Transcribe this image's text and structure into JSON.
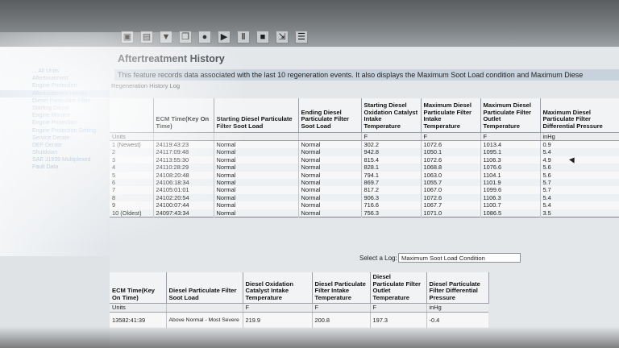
{
  "page": {
    "title": "Aftertreatment History",
    "description": "This feature records data associated with the last 10 regeneration events. It also displays the Maximum Soot Load condition and Maximum Diese",
    "log_label": "Regeneration History Log"
  },
  "toolbar": {
    "icons": [
      "save-icon",
      "print-icon",
      "filter-icon",
      "copy-icon",
      "record-icon",
      "play-icon",
      "pause-icon",
      "stop-icon",
      "export-icon",
      "report-icon"
    ]
  },
  "sidebar": {
    "items": [
      "... All Units",
      "Aftertreatment",
      "Engine Protection",
      "Aftertreatment History",
      "Diesel Particulate Filter",
      "Starting Diesel",
      "Engine Monitor",
      "Engine Protection",
      "Engine Protection Setting",
      "Service Derate",
      "DEF Derate",
      "Shutdown",
      "SAE J1939 Multiplexed",
      "Fault Data"
    ]
  },
  "regen_table": {
    "columns": [
      "ECM Time(Key On Time)",
      "Starting Diesel Particulate Filter Soot Load",
      "Ending Diesel Particulate Filter Soot Load",
      "Starting Diesel Oxidation Catalyst Intake Temperature",
      "Maximum Diesel Particulate Filter Intake Temperature",
      "Maximum Diesel Particulate Filter Outlet Temperature",
      "Maximum Diesel Particulate Filter Differential Pressure"
    ],
    "units_label": "Units",
    "units": [
      "",
      "",
      "",
      "F",
      "F",
      "F",
      "inHg"
    ],
    "rows": [
      {
        "idx": "1 (Newest)",
        "cells": [
          "24119:43:23",
          "Normal",
          "Normal",
          "302.2",
          "1072.6",
          "1013.4",
          "0.9"
        ]
      },
      {
        "idx": "2",
        "cells": [
          "24117:09:48",
          "Normal",
          "Normal",
          "942.8",
          "1050.1",
          "1095.1",
          "5.4"
        ]
      },
      {
        "idx": "3",
        "cells": [
          "24113:55:30",
          "Normal",
          "Normal",
          "815.4",
          "1072.6",
          "1106.3",
          "4.9"
        ]
      },
      {
        "idx": "4",
        "cells": [
          "24110:28:29",
          "Normal",
          "Normal",
          "828.1",
          "1068.8",
          "1076.6",
          "5.6"
        ]
      },
      {
        "idx": "5",
        "cells": [
          "24108:20:48",
          "Normal",
          "Normal",
          "794.1",
          "1063.0",
          "1104.1",
          "5.6"
        ]
      },
      {
        "idx": "6",
        "cells": [
          "24106:18:34",
          "Normal",
          "Normal",
          "869.7",
          "1055.7",
          "1101.9",
          "5.7"
        ]
      },
      {
        "idx": "7",
        "cells": [
          "24105:01:01",
          "Normal",
          "Normal",
          "817.2",
          "1067.0",
          "1099.6",
          "5.7"
        ]
      },
      {
        "idx": "8",
        "cells": [
          "24102:20:54",
          "Normal",
          "Normal",
          "906.3",
          "1072.6",
          "1106.3",
          "5.4"
        ]
      },
      {
        "idx": "9",
        "cells": [
          "24100:07:44",
          "Normal",
          "Normal",
          "716.6",
          "1067.7",
          "1100.7",
          "5.4"
        ]
      },
      {
        "idx": "10 (Oldest)",
        "cells": [
          "24097:43:34",
          "Normal",
          "Normal",
          "756.3",
          "1071.0",
          "1086.5",
          "3.5"
        ]
      }
    ]
  },
  "log_select": {
    "label": "Select a Log:",
    "value": "Maximum Soot Load Condition"
  },
  "soot_table": {
    "columns": [
      "ECM Time(Key On Time)",
      "Diesel Particulate Filter Soot Load",
      "Diesel Oxidation Catalyst Intake Temperature",
      "Diesel Particulate Filter Intake Temperature",
      "Diesel Particulate Filter Outlet Temperature",
      "Diesel Particulate Filter Differential Pressure"
    ],
    "units_label": "Units",
    "units": [
      "",
      "",
      "F",
      "F",
      "F",
      "inHg"
    ],
    "row": [
      "13582:41:39",
      "Above Normal - Most Severe",
      "219.9",
      "200.8",
      "197.3",
      "-0.4"
    ]
  }
}
